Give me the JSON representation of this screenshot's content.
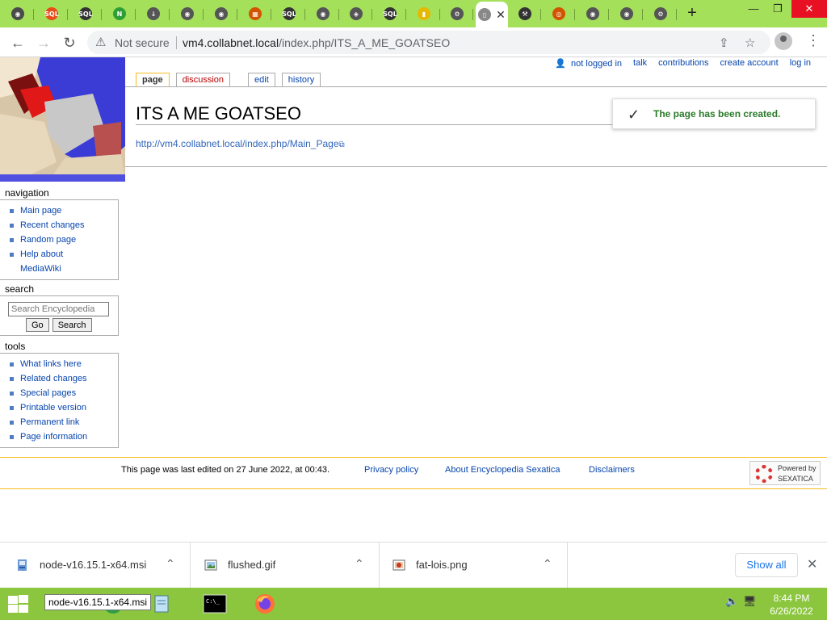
{
  "browser": {
    "tabs": [
      {
        "icon": "chrome-icon",
        "color": "#4a4a4a"
      },
      {
        "icon": "sql-icon",
        "color": "#e84c1a"
      },
      {
        "icon": "sql-icon",
        "color": "#333333"
      },
      {
        "icon": "node-icon",
        "color": "#2e9e36"
      },
      {
        "icon": "download-icon",
        "color": "#555555"
      },
      {
        "icon": "chrome-icon",
        "color": "#555555"
      },
      {
        "icon": "chrome-icon",
        "color": "#555555"
      },
      {
        "icon": "store-icon",
        "color": "#d35400"
      },
      {
        "icon": "sql-icon",
        "color": "#333333"
      },
      {
        "icon": "chrome-icon",
        "color": "#555555"
      },
      {
        "icon": "diamond-icon",
        "color": "#555555"
      },
      {
        "icon": "sql-icon",
        "color": "#333333"
      },
      {
        "icon": "folder-icon",
        "color": "#e6b800"
      },
      {
        "icon": "gear-icon",
        "color": "#555555"
      },
      {
        "icon": "page-icon",
        "color": "#888888",
        "active": true
      },
      {
        "icon": "wrench-icon",
        "color": "#333333"
      },
      {
        "icon": "target-icon",
        "color": "#d35400"
      },
      {
        "icon": "chrome-icon",
        "color": "#555555"
      },
      {
        "icon": "chrome-icon",
        "color": "#555555"
      },
      {
        "icon": "gear-icon",
        "color": "#555555"
      }
    ],
    "address": {
      "security_label": "Not secure",
      "host": "vm4.collabnet.local",
      "path": "/index.php/ITS_A_ME_GOATSEO"
    }
  },
  "wiki": {
    "personal": {
      "user": "not logged in",
      "talk": "talk",
      "contributions": "contributions",
      "create_account": "create account",
      "login": "log in"
    },
    "tabs": {
      "page": "page",
      "discussion": "discussion",
      "edit": "edit",
      "history": "history"
    },
    "title": "ITS A ME GOATSEO",
    "body_link": "http://vm4.collabnet.local/index.php/Main_Page",
    "notification": "The page has been created.",
    "navigation": {
      "heading": "navigation",
      "items": [
        "Main page",
        "Recent changes",
        "Random page",
        "Help about"
      ],
      "continuation": "MediaWiki"
    },
    "search": {
      "heading": "search",
      "placeholder": "Search Encyclopedia",
      "go": "Go",
      "search": "Search"
    },
    "tools": {
      "heading": "tools",
      "items": [
        "What links here",
        "Related changes",
        "Special pages",
        "Printable version",
        "Permanent link",
        "Page information"
      ]
    },
    "footer": {
      "last_modified": "This page was last edited on 27 June 2022, at 00:43.",
      "privacy": "Privacy policy",
      "about": "About Encyclopedia Sexatica",
      "disclaimers": "Disclaimers",
      "powered_line1": "Powered by",
      "powered_line2": "SEXATICA"
    }
  },
  "downloads": {
    "items": [
      {
        "name": "node-v16.15.1-x64.msi",
        "icon": "installer-icon"
      },
      {
        "name": "flushed.gif",
        "icon": "image-icon"
      },
      {
        "name": "fat-lois.png",
        "icon": "image-icon"
      }
    ],
    "show_all": "Show all"
  },
  "taskbar": {
    "tooltip": "node-v16.15.1-x64.msi",
    "time": "8:44 PM",
    "date": "6/26/2022"
  }
}
